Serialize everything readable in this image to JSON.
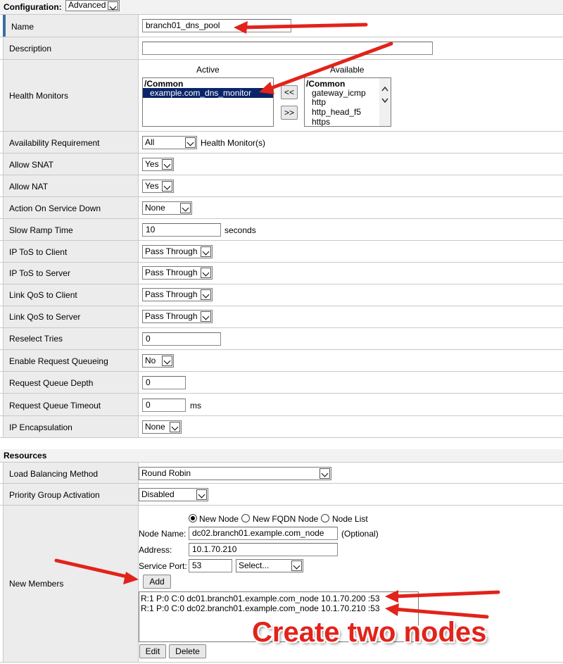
{
  "config": {
    "label": "Configuration:",
    "mode": "Advanced"
  },
  "fields": {
    "name": {
      "label": "Name",
      "value": "branch01_dns_pool"
    },
    "description": {
      "label": "Description",
      "value": ""
    },
    "health_monitors": {
      "label": "Health Monitors",
      "active_header": "Active",
      "available_header": "Available",
      "active_items": [
        "/Common",
        "example.com_dns_monitor"
      ],
      "available_items": [
        "/Common",
        "gateway_icmp",
        "http",
        "http_head_f5",
        "https"
      ],
      "btn_left": "<<",
      "btn_right": ">>"
    },
    "availability": {
      "label": "Availability Requirement",
      "value": "All",
      "suffix": "Health Monitor(s)"
    },
    "allow_snat": {
      "label": "Allow SNAT",
      "value": "Yes"
    },
    "allow_nat": {
      "label": "Allow NAT",
      "value": "Yes"
    },
    "action_on_down": {
      "label": "Action On Service Down",
      "value": "None"
    },
    "slow_ramp": {
      "label": "Slow Ramp Time",
      "value": "10",
      "suffix": "seconds"
    },
    "tos_client": {
      "label": "IP ToS to Client",
      "value": "Pass Through"
    },
    "tos_server": {
      "label": "IP ToS to Server",
      "value": "Pass Through"
    },
    "qos_client": {
      "label": "Link QoS to Client",
      "value": "Pass Through"
    },
    "qos_server": {
      "label": "Link QoS to Server",
      "value": "Pass Through"
    },
    "reselect": {
      "label": "Reselect Tries",
      "value": "0"
    },
    "queueing": {
      "label": "Enable Request Queueing",
      "value": "No"
    },
    "queue_depth": {
      "label": "Request Queue Depth",
      "value": "0"
    },
    "queue_timeout": {
      "label": "Request Queue Timeout",
      "value": "0",
      "suffix": "ms"
    },
    "encapsulation": {
      "label": "IP Encapsulation",
      "value": "None"
    }
  },
  "resources": {
    "title": "Resources",
    "lb_method": {
      "label": "Load Balancing Method",
      "value": "Round Robin"
    },
    "priority": {
      "label": "Priority Group Activation",
      "value": "Disabled"
    },
    "new_members": {
      "label": "New Members",
      "radio_new_node": "New Node",
      "radio_fqdn": "New FQDN Node",
      "radio_list": "Node List",
      "node_name_label": "Node Name:",
      "node_name_value": "dc02.branch01.example.com_node",
      "optional": "(Optional)",
      "address_label": "Address:",
      "address_value": "10.1.70.210",
      "port_label": "Service Port:",
      "port_value": "53",
      "port_select": "Select...",
      "add": "Add",
      "members": [
        "R:1 P:0 C:0 dc01.branch01.example.com_node 10.1.70.200 :53",
        "R:1 P:0 C:0 dc02.branch01.example.com_node 10.1.70.210 :53"
      ],
      "edit": "Edit",
      "delete": "Delete"
    }
  },
  "annotation": {
    "text": "Create two nodes",
    "color": "#e2231a"
  }
}
